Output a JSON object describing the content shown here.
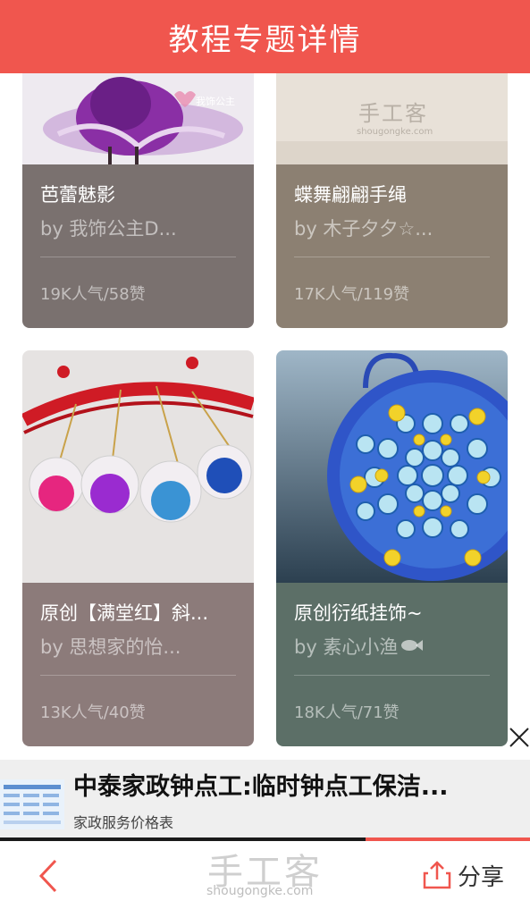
{
  "header": {
    "title": "教程专题详情"
  },
  "cards": [
    {
      "title": "芭蕾魅影",
      "author": "by 我饰公主D...",
      "stats": "19K人气/58赞",
      "watermark": "我饰公主",
      "info_color": "#7a716f"
    },
    {
      "title": "蝶舞翩翩手绳",
      "author": "by 木子夕夕☆...",
      "stats": "17K人气/119赞",
      "watermark_cn": "手工客",
      "watermark_en": "shougongke.com",
      "info_color": "#8c8072"
    },
    {
      "title": "原创【满堂红】斜...",
      "author": "by 思想家的怡...",
      "stats": "13K人气/40赞",
      "info_color": "#8c7b7a"
    },
    {
      "title": "原创衍纸挂饰~",
      "author": "by 素心小渔",
      "stats": "18K人气/71赞",
      "info_color": "#5c6f67"
    }
  ],
  "ad": {
    "title": "中泰家政钟点工:临时钟点工保洁...",
    "subtitle": "家政服务价格表",
    "progress_fraction": 0.31
  },
  "bottom_bar": {
    "brand_cn": "手工客",
    "brand_en": "shougongke.com",
    "share_label": "分享"
  },
  "colors": {
    "accent": "#f0564e"
  },
  "icons": {
    "back": "chevron-left-icon",
    "share": "share-icon",
    "close": "close-icon"
  }
}
